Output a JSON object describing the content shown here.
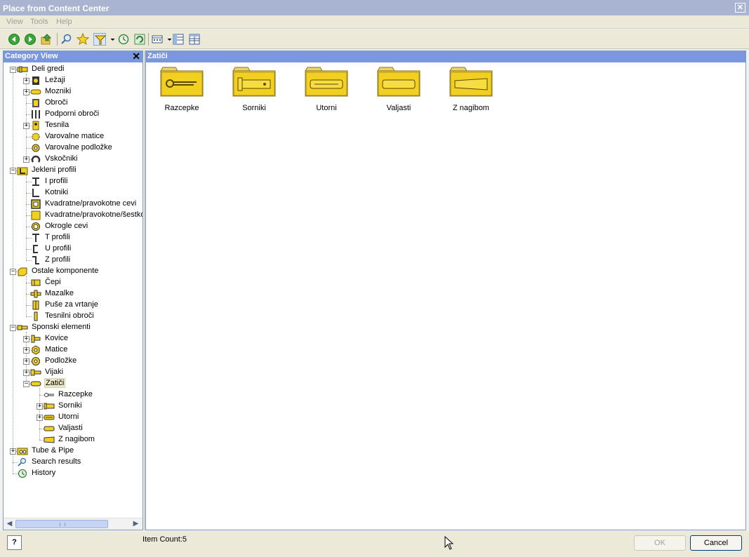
{
  "window": {
    "title": "Place from Content Center",
    "close_glyph": "✕"
  },
  "menu": [
    "View",
    "Tools",
    "Help"
  ],
  "toolbar": {
    "icons": [
      "back-icon",
      "forward-icon",
      "up-folder-icon",
      "search-icon",
      "favorites-icon",
      "filter-icon",
      "filter-dropdown-icon",
      "history-icon",
      "refresh-icon",
      "view-mode-icon",
      "view-mode-dropdown-icon",
      "table-view-icon",
      "detail-view-icon"
    ]
  },
  "category_view": {
    "title": "Category View",
    "close_glyph": "✕",
    "tree": [
      {
        "label": "Deli gredi",
        "level": 0,
        "expander": "-",
        "icon": "shaft-parts-icon"
      },
      {
        "label": "Ležaji",
        "level": 1,
        "expander": "+",
        "icon": "bearing-icon"
      },
      {
        "label": "Mozniki",
        "level": 1,
        "expander": "+",
        "icon": "key-icon"
      },
      {
        "label": "Obroči",
        "level": 1,
        "expander": "",
        "icon": "ring-icon"
      },
      {
        "label": "Podporni obroči",
        "level": 1,
        "expander": "",
        "icon": "support-ring-icon"
      },
      {
        "label": "Tesnila",
        "level": 1,
        "expander": "+",
        "icon": "seal-icon"
      },
      {
        "label": "Varovalne matice",
        "level": 1,
        "expander": "",
        "icon": "lock-nut-icon"
      },
      {
        "label": "Varovalne podložke",
        "level": 1,
        "expander": "",
        "icon": "lock-washer-icon"
      },
      {
        "label": "Vskočniki",
        "level": 1,
        "expander": "+",
        "icon": "circlip-icon"
      },
      {
        "label": "Jekleni profili",
        "level": 0,
        "expander": "-",
        "icon": "steel-profile-icon"
      },
      {
        "label": "I profili",
        "level": 1,
        "expander": "",
        "icon": "i-profile-icon"
      },
      {
        "label": "Kotniki",
        "level": 1,
        "expander": "",
        "icon": "angle-profile-icon"
      },
      {
        "label": "Kvadratne/pravokotne cevi",
        "level": 1,
        "expander": "",
        "icon": "square-tube-icon"
      },
      {
        "label": "Kvadratne/pravokotne/šestkotne",
        "level": 1,
        "expander": "",
        "icon": "square-bar-icon"
      },
      {
        "label": "Okrogle cevi",
        "level": 1,
        "expander": "",
        "icon": "round-tube-icon"
      },
      {
        "label": "T profili",
        "level": 1,
        "expander": "",
        "icon": "t-profile-icon"
      },
      {
        "label": "U profili",
        "level": 1,
        "expander": "",
        "icon": "u-profile-icon"
      },
      {
        "label": "Z profili",
        "level": 1,
        "expander": "",
        "icon": "z-profile-icon"
      },
      {
        "label": "Ostale komponente",
        "level": 0,
        "expander": "-",
        "icon": "other-components-icon"
      },
      {
        "label": "Čepi",
        "level": 1,
        "expander": "",
        "icon": "plug-icon"
      },
      {
        "label": "Mazalke",
        "level": 1,
        "expander": "",
        "icon": "grease-nipple-icon"
      },
      {
        "label": "Puše za vrtanje",
        "level": 1,
        "expander": "",
        "icon": "drill-bushing-icon"
      },
      {
        "label": "Tesnilni obroči",
        "level": 1,
        "expander": "",
        "icon": "seal-ring-icon"
      },
      {
        "label": "Sponski elementi",
        "level": 0,
        "expander": "-",
        "icon": "fasteners-icon"
      },
      {
        "label": "Kovice",
        "level": 1,
        "expander": "+",
        "icon": "rivet-icon"
      },
      {
        "label": "Matice",
        "level": 1,
        "expander": "+",
        "icon": "nut-icon"
      },
      {
        "label": "Podložke",
        "level": 1,
        "expander": "+",
        "icon": "washer-icon"
      },
      {
        "label": "Vijaki",
        "level": 1,
        "expander": "+",
        "icon": "bolt-icon"
      },
      {
        "label": "Zatiči",
        "level": 1,
        "expander": "-",
        "icon": "pin-icon",
        "selected": true
      },
      {
        "label": "Razcepke",
        "level": 2,
        "expander": "",
        "icon": "cotter-pin-icon"
      },
      {
        "label": "Sorniki",
        "level": 2,
        "expander": "+",
        "icon": "clevis-pin-icon"
      },
      {
        "label": "Utorni",
        "level": 2,
        "expander": "+",
        "icon": "grooved-pin-icon"
      },
      {
        "label": "Valjasti",
        "level": 2,
        "expander": "",
        "icon": "cylindrical-pin-icon"
      },
      {
        "label": "Z nagibom",
        "level": 2,
        "expander": "",
        "icon": "taper-pin-icon"
      },
      {
        "label": "Tube & Pipe",
        "level": 0,
        "expander": "+",
        "icon": "tube-pipe-icon"
      },
      {
        "label": "Search results",
        "level": 0,
        "expander": "",
        "icon": "search-icon"
      },
      {
        "label": "History",
        "level": 0,
        "expander": "",
        "icon": "history-icon"
      }
    ]
  },
  "content": {
    "title": "Zatiči",
    "items": [
      {
        "label": "Razcepke",
        "icon": "cotter-pin-folder-icon"
      },
      {
        "label": "Sorniki",
        "icon": "clevis-pin-folder-icon"
      },
      {
        "label": "Utorni",
        "icon": "grooved-pin-folder-icon"
      },
      {
        "label": "Valjasti",
        "icon": "cylindrical-pin-folder-icon"
      },
      {
        "label": "Z nagibom",
        "icon": "taper-pin-folder-icon"
      }
    ]
  },
  "status": {
    "help_label": "?",
    "item_count": "Item Count:5",
    "ok_label": "OK",
    "cancel_label": "Cancel"
  },
  "colors": {
    "panel_header": "#7a96df",
    "title_bar": "#a9b4d0",
    "folder_yellow": "#f2d021"
  }
}
